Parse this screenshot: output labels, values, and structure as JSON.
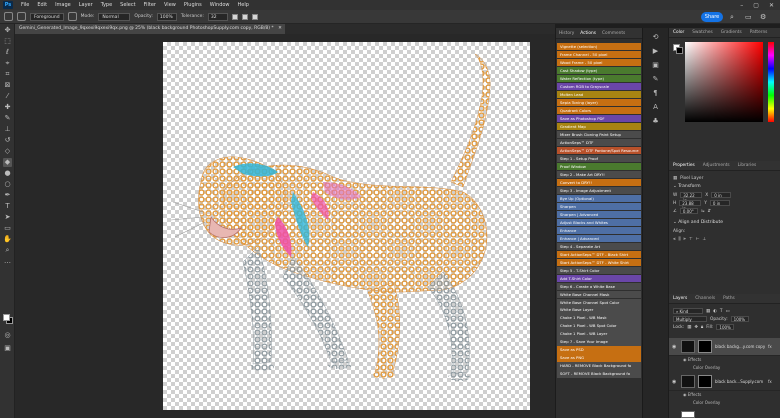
{
  "menu": {
    "logo": "Ps",
    "items": [
      "File",
      "Edit",
      "Image",
      "Layer",
      "Type",
      "Select",
      "Filter",
      "View",
      "Plugins",
      "Window",
      "Help"
    ]
  },
  "options_bar": {
    "sample_select": "Foreground",
    "mode_label": "Mode:",
    "mode_value": "Normal",
    "opacity_label": "Opacity:",
    "opacity_value": "100%",
    "tolerance_label": "Tolerance:",
    "tolerance_value": "32",
    "share_label": "Share"
  },
  "document": {
    "tab_title": "Gemini_Generated_Image_9qxexi9qxexi9qx.png @ 25% (black background PhotoshopSupply.com copy, RGB/8) *"
  },
  "actions_panel": {
    "tabs": [
      "History",
      "Actions",
      "Comments"
    ],
    "active_tab": "Actions",
    "items": [
      {
        "label": "Vignette (selection)",
        "color": "orange"
      },
      {
        "label": "Frame Channel - 50 pixel",
        "color": "orange"
      },
      {
        "label": "Wood Frame - 50 pixel",
        "color": "orange"
      },
      {
        "label": "Cast Shadow (type)",
        "color": "green"
      },
      {
        "label": "Water Reflection (type)",
        "color": "green"
      },
      {
        "label": "Custom RGB to Grayscale",
        "color": "purple"
      },
      {
        "label": "Molten Lead",
        "color": "yellow"
      },
      {
        "label": "Sepia Toning (layer)",
        "color": "orange"
      },
      {
        "label": "Quadrant Colors",
        "color": "orange"
      },
      {
        "label": "Save as Photoshop PDF",
        "color": "purple"
      },
      {
        "label": "Gradient Map",
        "color": "yellow"
      },
      {
        "label": "Mixer Brush Cloning Paint Setup",
        "color": "gray"
      },
      {
        "label": "ActionSeps™ DTF",
        "color": "gray"
      },
      {
        "label": "ActionSeps™ DTF Pantone/Spot Resource",
        "color": "red"
      },
      {
        "label": "Step 1 - Setup Proof",
        "color": "gray"
      },
      {
        "label": "Proof Window",
        "color": "green"
      },
      {
        "label": "Step 2 - Make Art DRY!!",
        "color": "gray"
      },
      {
        "label": "Convert to DRY!!",
        "color": "orange"
      },
      {
        "label": "Step 3 - Image Adjustment",
        "color": "gray"
      },
      {
        "label": "Bye Up (Optional)",
        "color": "blue"
      },
      {
        "label": "Sharpen",
        "color": "blue"
      },
      {
        "label": "Sharpen | Advanced",
        "color": "blue"
      },
      {
        "label": "Adjust Blacks and Whites",
        "color": "blue"
      },
      {
        "label": "Enhance",
        "color": "blue"
      },
      {
        "label": "Enhance | Advanced",
        "color": "blue"
      },
      {
        "label": "Step 4 - Separate Art",
        "color": "gray"
      },
      {
        "label": "Start ActionSeps™ DTF - Black Shirt",
        "color": "orange"
      },
      {
        "label": "Start ActionSeps™ DTF - White Shirt",
        "color": "orange"
      },
      {
        "label": "Step 5 - T-Shirt Color",
        "color": "gray"
      },
      {
        "label": "Add T-Shirt Color",
        "color": "purple"
      },
      {
        "label": "Step 6 - Create a White Base",
        "color": "gray"
      },
      {
        "label": "White Base Channel Mask",
        "color": "gray"
      },
      {
        "label": "White Base Channel Spot Color",
        "color": "gray"
      },
      {
        "label": "White Base Layer",
        "color": "gray"
      },
      {
        "label": "Choke 1 Pixel - WB Mask",
        "color": "gray"
      },
      {
        "label": "Choke 1 Pixel - WB Spot Color",
        "color": "gray"
      },
      {
        "label": "Choke 1 Pixel - WB Layer",
        "color": "gray"
      },
      {
        "label": "Step 7 - Save Your Image",
        "color": "gray"
      },
      {
        "label": "Save as PSD",
        "color": "orange"
      },
      {
        "label": "Save as PNG",
        "color": "orange"
      },
      {
        "label": "HARD - REMOVE Black Background fo",
        "color": "gray"
      },
      {
        "label": "SOFT - REMOVE Black Background fo",
        "color": "gray"
      }
    ]
  },
  "color_panel": {
    "tabs": [
      "Color",
      "Swatches",
      "Gradients",
      "Patterns"
    ],
    "active_tab": "Color"
  },
  "properties_panel": {
    "tabs": [
      "Properties",
      "Adjustments",
      "Libraries"
    ],
    "active_tab": "Properties",
    "layer_type": "Pixel Layer",
    "transform_header": "Transform",
    "w_label": "W",
    "w_value": "32.22 in",
    "h_label": "H",
    "h_value": "23.88 in",
    "x_label": "X",
    "x_value": "0 in",
    "y_label": "Y",
    "y_value": "0 in",
    "angle_value": "0.00°",
    "align_header": "Align and Distribute",
    "align_label": "Align:"
  },
  "layers_panel": {
    "tabs": [
      "Layers",
      "Channels",
      "Paths"
    ],
    "active_tab": "Layers",
    "kind_label": "Kind",
    "blend_mode": "Multiply",
    "opacity_label": "Opacity:",
    "opacity_value": "100%",
    "lock_label": "Lock:",
    "fill_label": "Fill:",
    "fill_value": "100%",
    "layers": [
      {
        "name": "black backg...y.com copy",
        "effects_label": "Effects",
        "effect": "Color Overlay",
        "selected": true
      },
      {
        "name": "black back...Supply.com",
        "effects_label": "Effects",
        "effect": "Color Overlay",
        "selected": false
      }
    ]
  }
}
